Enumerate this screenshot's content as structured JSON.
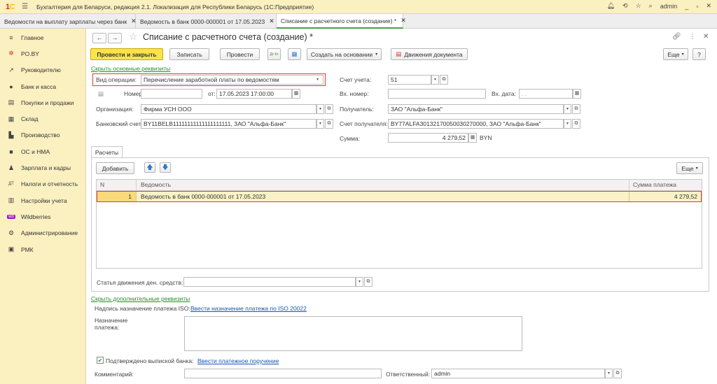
{
  "app": {
    "title": "Бухгалтерия для Беларуси, редакция 2.1. Локализация для Республики Беларусь   (1С:Предприятие)",
    "logo": "1С",
    "user": "admin"
  },
  "tabs": [
    {
      "label": "Ведомости на выплату зарплаты через банк"
    },
    {
      "label": "Ведомость в банк 0000-000001 от 17.05.2023"
    },
    {
      "label": "Списание с расчетного счета (создание) *"
    }
  ],
  "sidebar": {
    "items": [
      {
        "label": "Главное",
        "icon": "menu-icon"
      },
      {
        "label": "PO.BY",
        "icon": "star-icon"
      },
      {
        "label": "Руководителю",
        "icon": "chart-icon"
      },
      {
        "label": "Банк и касса",
        "icon": "bank-icon"
      },
      {
        "label": "Покупки и продажи",
        "icon": "cart-icon"
      },
      {
        "label": "Склад",
        "icon": "warehouse-icon"
      },
      {
        "label": "Производство",
        "icon": "factory-icon"
      },
      {
        "label": "ОС и НМА",
        "icon": "truck-icon"
      },
      {
        "label": "Зарплата и кадры",
        "icon": "people-icon"
      },
      {
        "label": "Налоги и отчетность",
        "icon": "tax-icon"
      },
      {
        "label": "Настройки учета",
        "icon": "settings-icon"
      },
      {
        "label": "Wildberries",
        "icon": "wb-icon"
      },
      {
        "label": "Администрирование",
        "icon": "gear-icon"
      },
      {
        "label": "РМК",
        "icon": "pos-icon"
      }
    ]
  },
  "form": {
    "title": "Списание с расчетного счета (создание) *",
    "toolbar": {
      "post_close": "Провести и закрыть",
      "save": "Записать",
      "post": "Провести",
      "dt_kt": "Дт Кт",
      "create_based": "Создать на основании",
      "movements": "Движения документа",
      "more": "Еще",
      "help": "?"
    },
    "hide_main_link": "Скрыть основные реквизиты",
    "vid_label": "Вид операции:",
    "vid_value": "Перечисление заработной платы по ведомостям",
    "number_label": "Номер",
    "number_value": "",
    "from_label": "от:",
    "from_value": "17.05.2023 17:00:00",
    "org_label": "Организация:",
    "org_value": "Фирма УСН ООО",
    "bank_acc_label": "Банковский счет:",
    "bank_acc_value": "BY11BELB11111111111111111111, ЗАО \"Альфа-Банк\"",
    "account_label": "Счет учета:",
    "account_value": "51",
    "in_number_label": "Вх. номер:",
    "in_number_value": "",
    "in_date_label": "Вх. дата:",
    "in_date_value": " .  .",
    "recipient_label": "Получатель:",
    "recipient_value": "ЗАО \"Альфа-Банк\"",
    "recipient_acc_label": "Счет получателя:",
    "recipient_acc_value": "BY77ALFA30132170050030270000, ЗАО \"Альфа-Банк\"",
    "sum_label": "Сумма:",
    "sum_value": "4 279,52",
    "currency": "BYN"
  },
  "calc": {
    "tab_label": "Расчеты",
    "add_button": "Добавить",
    "more": "Еще",
    "columns": [
      "N",
      "Ведомость",
      "Сумма платежа"
    ],
    "rows": [
      {
        "n": "1",
        "vedomost": "Ведомость в банк 0000-000001 от 17.05.2023",
        "sum": "4 279,52"
      }
    ],
    "article_label": "Статья движения ден. средств:",
    "article_value": ""
  },
  "extra": {
    "hide_extra_link": "Скрыть дополнительные реквизиты",
    "iso_label": "Надпись назначение платежа ISO:",
    "iso_link": "Ввести назначение платежа по ISO 20022",
    "purpose_label": "Назначение платежа:",
    "confirmed_label": "Подтверждено выпиской банка:",
    "confirmed_checked": true,
    "payment_order_link": "Ввести платежное поручение",
    "comment_label": "Комментарий:",
    "comment_value": "",
    "responsible_label": "Ответственный:",
    "responsible_value": "admin"
  },
  "colors": {
    "accent_yellow": "#fbe44a",
    "sidebar_bg": "#fbf0c0",
    "green_link": "#2b8a2b",
    "highlight_red": "#e53935"
  }
}
